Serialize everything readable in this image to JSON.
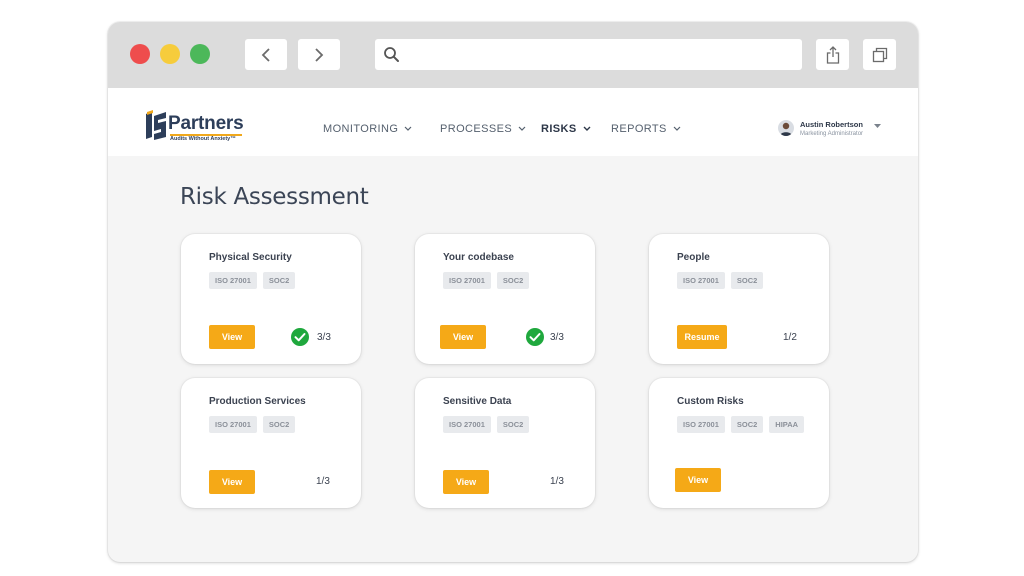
{
  "browser": {
    "search_placeholder": "",
    "colors": {
      "close": "#ee4d4d",
      "minimize": "#f6cc3c",
      "maximize": "#4cb85a"
    }
  },
  "app": {
    "logo": {
      "brand": "Partners",
      "tagline": "Audits Without Anxiety™"
    },
    "nav": [
      {
        "label": "MONITORING",
        "active": false
      },
      {
        "label": "PROCESSES",
        "active": false
      },
      {
        "label": "RISKS",
        "active": true
      },
      {
        "label": "REPORTS",
        "active": false
      }
    ],
    "user": {
      "name": "Austin Robertson",
      "role": "Marketing Administrator"
    }
  },
  "page": {
    "title": "Risk Assessment"
  },
  "cards": [
    {
      "title": "Physical Security",
      "tags": [
        "ISO 27001",
        "SOC2"
      ],
      "button": "View",
      "progress": "3/3",
      "complete": true
    },
    {
      "title": "Your codebase",
      "tags": [
        "ISO 27001",
        "SOC2"
      ],
      "button": "View",
      "progress": "3/3",
      "complete": true
    },
    {
      "title": "People",
      "tags": [
        "ISO 27001",
        "SOC2"
      ],
      "button": "Resume",
      "progress": "1/2",
      "complete": false
    },
    {
      "title": "Production Services",
      "tags": [
        "ISO 27001",
        "SOC2"
      ],
      "button": "View",
      "progress": "1/3",
      "complete": false
    },
    {
      "title": "Sensitive Data",
      "tags": [
        "ISO 27001",
        "SOC2"
      ],
      "button": "View",
      "progress": "1/3",
      "complete": false
    },
    {
      "title": "Custom Risks",
      "tags": [
        "ISO 27001",
        "SOC2",
        "HIPAA"
      ],
      "button": "View",
      "progress": "",
      "complete": false
    }
  ],
  "colors": {
    "accent": "#f5a917",
    "success": "#1fa83d",
    "navy": "#2d3e5a"
  }
}
